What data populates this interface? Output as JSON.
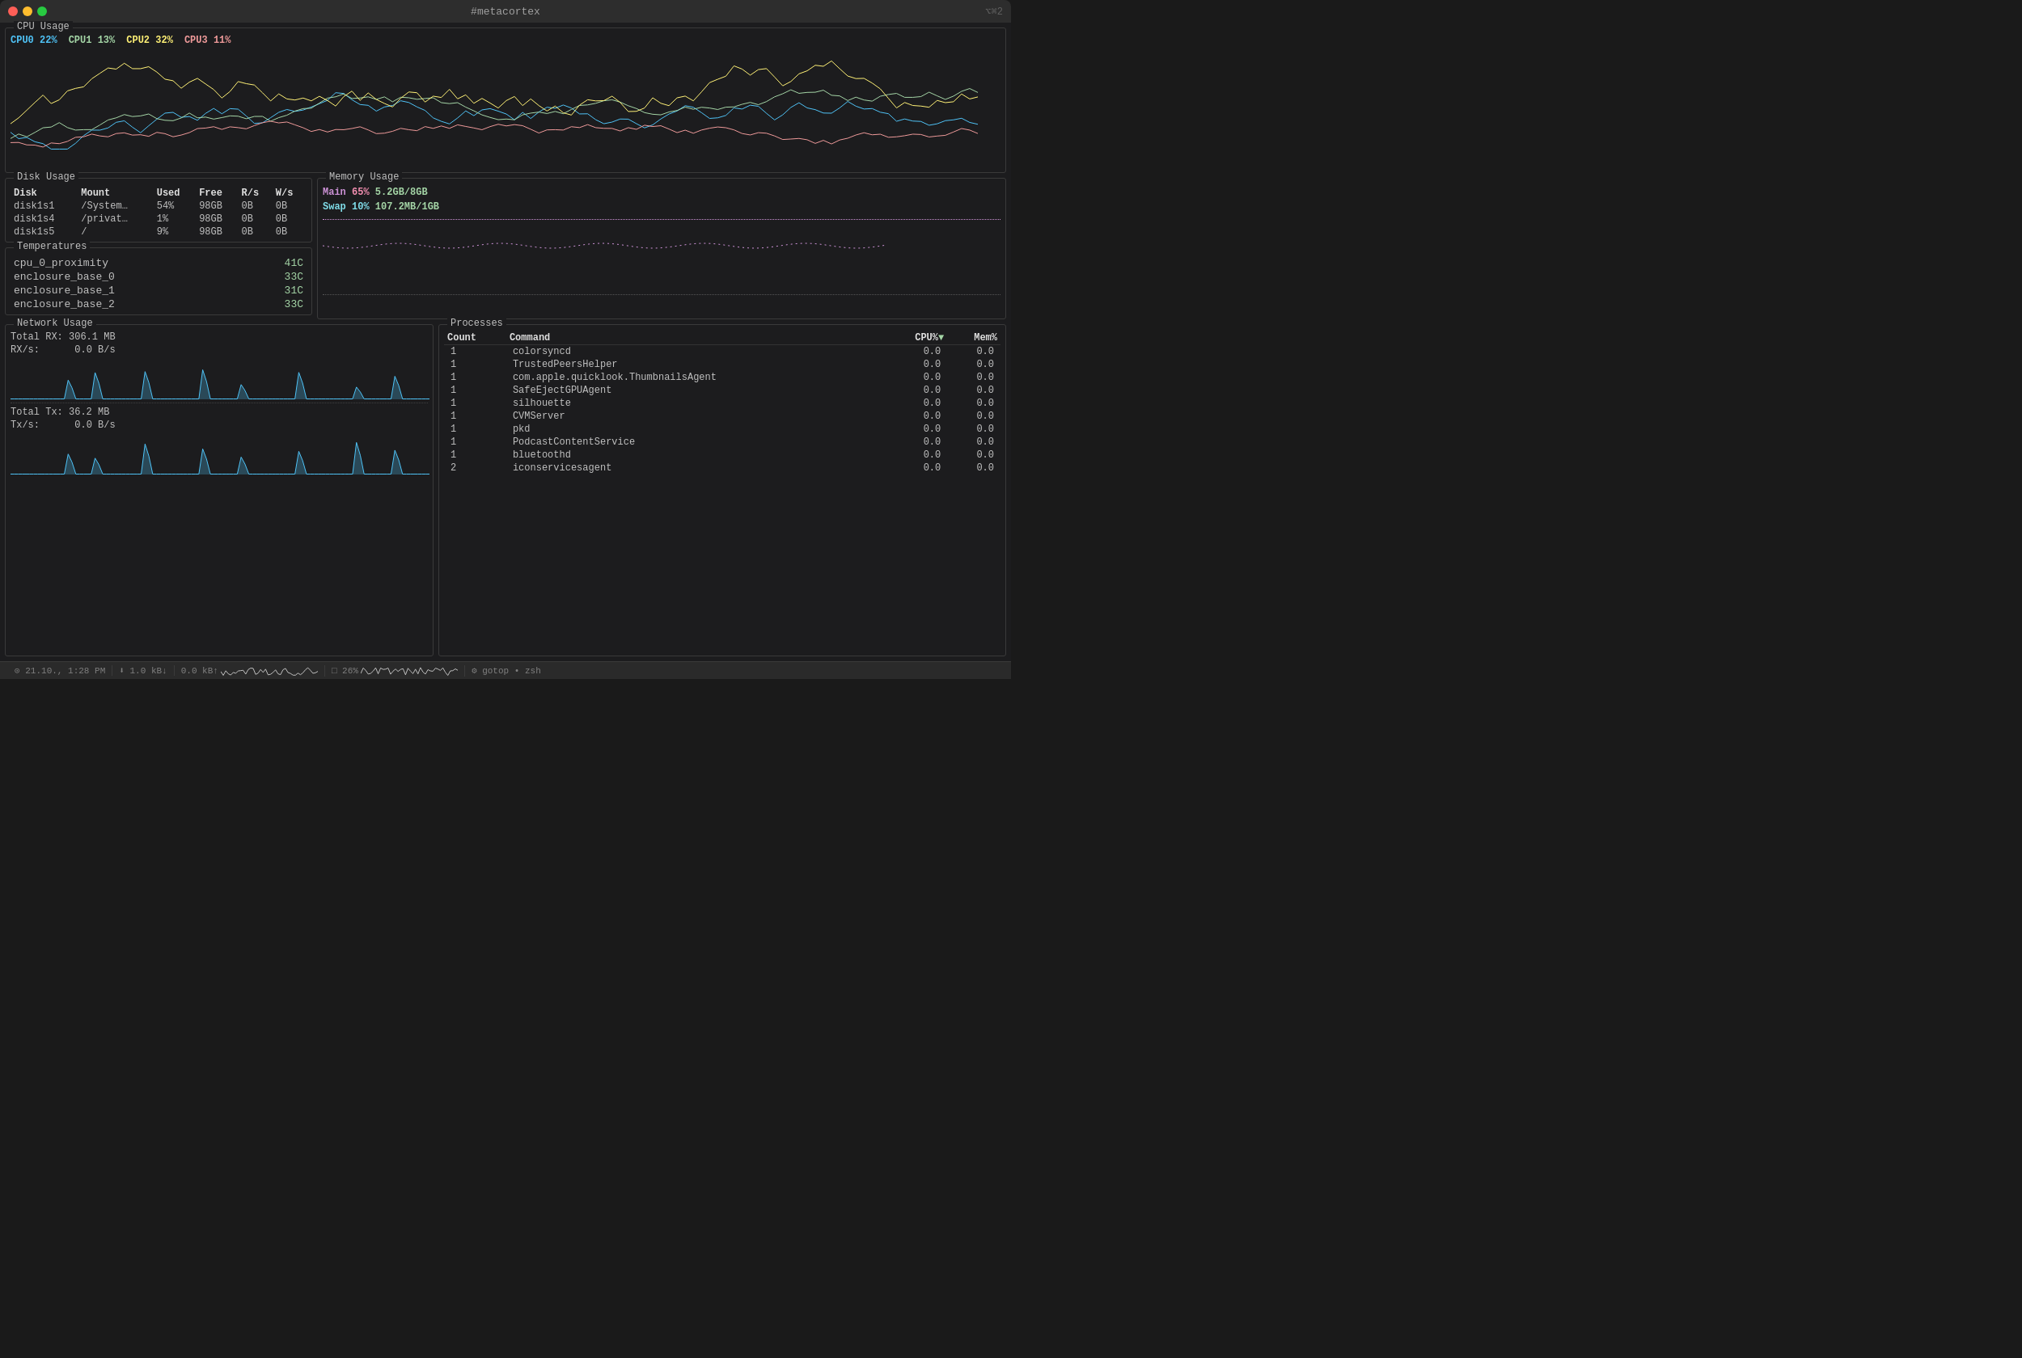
{
  "titlebar": {
    "title": "#metacortex",
    "shortcut": "⌥⌘2"
  },
  "cpu": {
    "section_title": "CPU Usage",
    "cores": [
      {
        "label": "CPU0",
        "pct": "22%",
        "color": "#4fc3f7"
      },
      {
        "label": "CPU1",
        "pct": "13%",
        "color": "#a5d6a7"
      },
      {
        "label": "CPU2",
        "pct": "32%",
        "color": "#fff176"
      },
      {
        "label": "CPU3",
        "pct": "11%",
        "color": "#ef9a9a"
      }
    ]
  },
  "disk": {
    "section_title": "Disk Usage",
    "headers": [
      "Disk",
      "Mount",
      "Used",
      "Free",
      "R/s",
      "W/s"
    ],
    "rows": [
      {
        "disk": "disk1s1",
        "mount": "/System…",
        "used": "54%",
        "free": "98GB",
        "rs": "0B",
        "ws": "0B"
      },
      {
        "disk": "disk1s4",
        "mount": "/privat…",
        "used": "1%",
        "free": "98GB",
        "rs": "0B",
        "ws": "0B"
      },
      {
        "disk": "disk1s5",
        "mount": "/",
        "used": "9%",
        "free": "98GB",
        "rs": "0B",
        "ws": "0B"
      }
    ]
  },
  "memory": {
    "section_title": "Memory Usage",
    "main_label": "Main",
    "main_pct": "65%",
    "main_val": "5.2GB/8GB",
    "swap_label": "Swap",
    "swap_pct": "10%",
    "swap_val": "107.2MB/1GB",
    "main_fill": 65
  },
  "temperatures": {
    "section_title": "Temperatures",
    "rows": [
      {
        "name": "cpu_0_proximity",
        "value": "41C"
      },
      {
        "name": "enclosure_base_0",
        "value": "33C"
      },
      {
        "name": "enclosure_base_1",
        "value": "31C"
      },
      {
        "name": "enclosure_base_2",
        "value": "33C"
      }
    ]
  },
  "network": {
    "section_title": "Network Usage",
    "total_rx_label": "Total RX:",
    "total_rx_val": "306.1 MB",
    "rxs_label": "RX/s:",
    "rxs_val": "0.0  B/s",
    "total_tx_label": "Total Tx:",
    "total_tx_val": "36.2 MB",
    "txs_label": "Tx/s:",
    "txs_val": "0.0  B/s"
  },
  "processes": {
    "section_title": "Processes",
    "headers": [
      "Count",
      "Command",
      "CPU%▼",
      "Mem%"
    ],
    "rows": [
      {
        "count": "1",
        "command": "colorsyncd",
        "cpu": "0.0",
        "mem": "0.0"
      },
      {
        "count": "1",
        "command": "TrustedPeersHelper",
        "cpu": "0.0",
        "mem": "0.0"
      },
      {
        "count": "1",
        "command": "com.apple.quicklook.ThumbnailsAgent",
        "cpu": "0.0",
        "mem": "0.0"
      },
      {
        "count": "1",
        "command": "SafeEjectGPUAgent",
        "cpu": "0.0",
        "mem": "0.0"
      },
      {
        "count": "1",
        "command": "silhouette",
        "cpu": "0.0",
        "mem": "0.0"
      },
      {
        "count": "1",
        "command": "CVMServer",
        "cpu": "0.0",
        "mem": "0.0"
      },
      {
        "count": "1",
        "command": "pkd",
        "cpu": "0.0",
        "mem": "0.0"
      },
      {
        "count": "1",
        "command": "PodcastContentService",
        "cpu": "0.0",
        "mem": "0.0"
      },
      {
        "count": "1",
        "command": "bluetoothd",
        "cpu": "0.0",
        "mem": "0.0"
      },
      {
        "count": "2",
        "command": "iconservicesagent",
        "cpu": "0.0",
        "mem": "0.0"
      }
    ]
  },
  "statusbar": {
    "datetime": "⊙ 21.10., 1:28 PM",
    "net_down": "⬇ 1.0 kB↓",
    "net_up": "0.0 kB↑",
    "cpu_pct": "□ 26%",
    "app_label": "⚙ gotop • zsh"
  }
}
